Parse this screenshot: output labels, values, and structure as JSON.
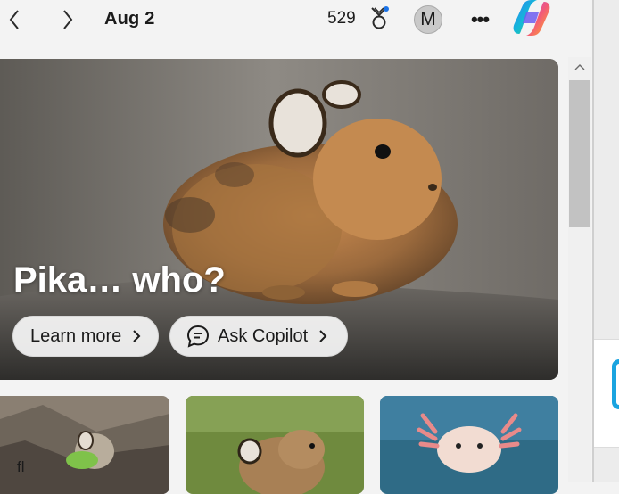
{
  "topbar": {
    "back_icon": "chevron-left-icon",
    "forward_icon": "chevron-right-icon",
    "date": "Aug 2",
    "points": "529",
    "rewards_icon": "trophy-icon",
    "avatar_letter": "M",
    "more_label": "•••",
    "copilot_icon": "copilot-logo-icon"
  },
  "hero": {
    "title": "Pika… who?",
    "learn_more_label": "Learn more",
    "ask_copilot_label": "Ask Copilot",
    "chat_icon": "chat-bubble-icon"
  },
  "cards": [
    {
      "subject": "pika-with-leaf"
    },
    {
      "subject": "pika-on-grass"
    },
    {
      "subject": "axolotl"
    }
  ],
  "right_pane": {
    "text": "fl"
  },
  "colors": {
    "background": "#f3f3f3",
    "accent_blue": "#1aa4e0",
    "scroll_thumb": "#c2c2c2"
  }
}
